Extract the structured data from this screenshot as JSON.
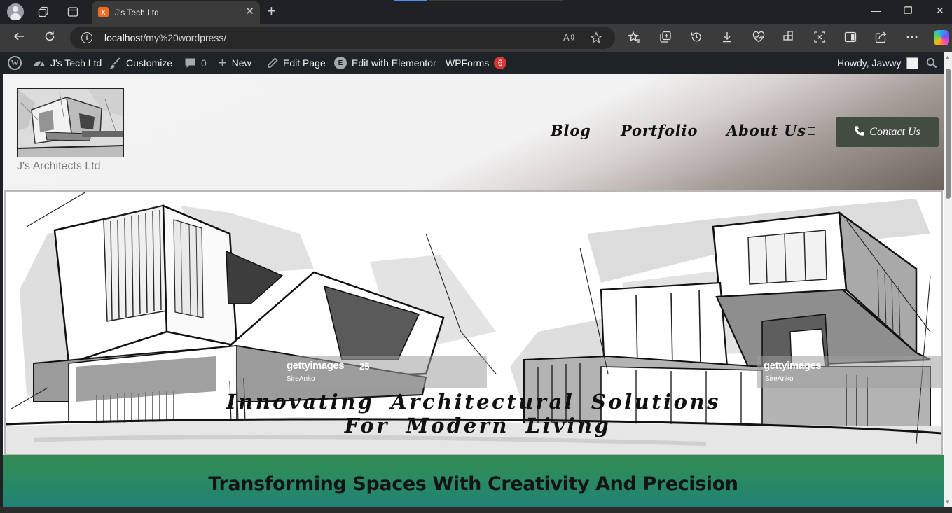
{
  "browser": {
    "tab": {
      "title": "J's Tech Ltd",
      "favicon_text": "X",
      "close_glyph": "✕"
    },
    "new_tab_glyph": "+",
    "window_controls": {
      "minimize": "—",
      "restore": "❐",
      "close": "✕"
    },
    "address": {
      "host": "localhost",
      "path": "/my%20wordpress/"
    },
    "icons": {
      "back": "back-arrow-icon",
      "refresh": "refresh-icon",
      "info": "info-icon",
      "read_aloud": "read-aloud-icon",
      "favorite": "star-icon",
      "favorites": "favorites-icon",
      "collections": "collections-icon",
      "history": "history-icon",
      "downloads": "download-icon",
      "performance": "heartbeat-icon",
      "extensions": "extensions-icon",
      "screenshot": "screenshot-icon",
      "split": "split-screen-icon",
      "share": "share-icon",
      "more": "more-icon",
      "copilot": "copilot-icon"
    }
  },
  "adminbar": {
    "site": "J's Tech Ltd",
    "customize": "Customize",
    "comments_count": "0",
    "new": "New",
    "edit_page": "Edit Page",
    "edit_elementor": "Edit with Elementor",
    "wpforms": "WPForms",
    "wpforms_badge": "6",
    "howdy": "Howdy, Jawwy"
  },
  "site": {
    "name": "J's Architects Ltd",
    "menu": [
      "Blog",
      "Portfolio",
      "About Us"
    ],
    "contact_label": "Contact Us",
    "hero": {
      "line1": "Innovating Architectural Solutions",
      "line2": "For Modern Living",
      "watermark": "gettyimages",
      "watermark_credit": "SireAnko",
      "watermark_badge": "25"
    },
    "band_title": "Transforming Spaces With Creativity And Precision"
  },
  "colors": {
    "adminbar_bg": "#1d2327",
    "contact_btn": "#424c41",
    "band_green": "#2a8a62",
    "badge_red": "#d63638"
  }
}
